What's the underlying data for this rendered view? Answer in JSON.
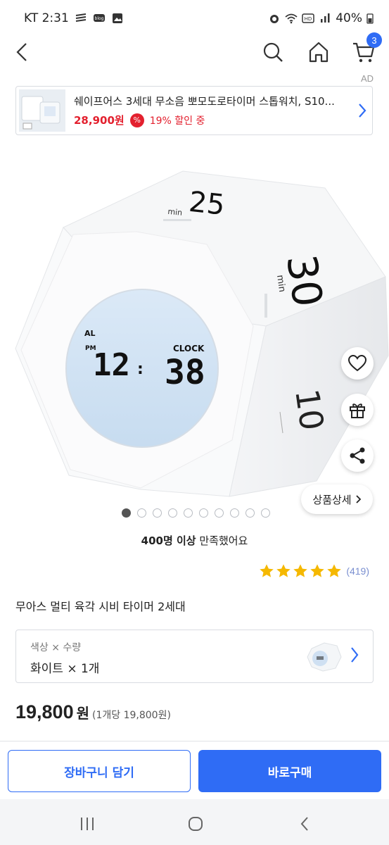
{
  "status_bar": {
    "carrier_time": "KT 2:31",
    "battery": "40%",
    "icons": [
      "stack-icon",
      "blog-icon",
      "image-icon",
      "alarm-icon",
      "wifi-icon",
      "hd-icon",
      "signal-icon",
      "battery-icon"
    ]
  },
  "nav": {
    "cart_count": "3",
    "icons": [
      "back-arrow-icon",
      "search-icon",
      "home-icon",
      "cart-icon"
    ]
  },
  "ad": {
    "label": "AD",
    "title": "쉐이프어스 3세대 무소음 뽀모도로타이머 스톱워치, S10...",
    "price": "28,900원",
    "pct_symbol": "%",
    "discount": "19% 할인 중"
  },
  "product_image": {
    "face_top": "25",
    "face_top_unit": "min",
    "face_right": "30",
    "face_right_unit": "min",
    "face_side": "10",
    "lcd_al": "AL",
    "lcd_pm": "PM",
    "lcd_clock": "CLOCK",
    "lcd_hour": "12",
    "lcd_sep": ":",
    "lcd_min": "38"
  },
  "floating": {
    "detail_label": "상품상세"
  },
  "gallery": {
    "total": 10,
    "active_index": 0
  },
  "satisfaction": {
    "bold": "400명 이상",
    "rest": " 만족했어요"
  },
  "rating": {
    "stars": 5,
    "count": "(419)",
    "star_color": "#f5b800"
  },
  "product": {
    "title": "무아스 멀티 육각 시비 타이머 2세대"
  },
  "option": {
    "label": "색상 × 수량",
    "value": "화이트 × 1개"
  },
  "price": {
    "amount": "19,800",
    "unit": "원",
    "per_unit": "(1개당 19,800원)"
  },
  "buttons": {
    "cart": "장바구니 담기",
    "buy": "바로구매",
    "accent": "#2f6cf5"
  },
  "system_nav": {
    "icons": [
      "recents-icon",
      "home-circle-icon",
      "back-chevron-icon"
    ]
  }
}
